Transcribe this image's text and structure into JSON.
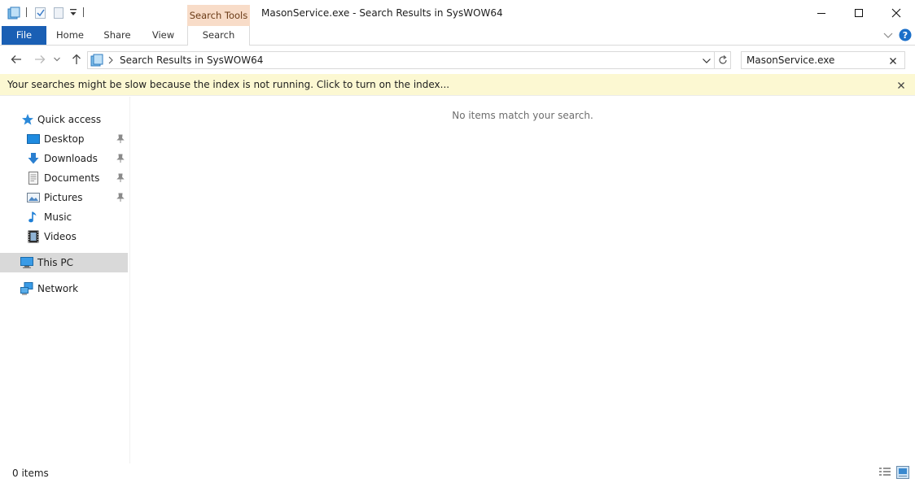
{
  "window": {
    "title": "MasonService.exe - Search Results in SysWOW64",
    "contextual_tab_group": "Search Tools"
  },
  "ribbon": {
    "tabs": [
      {
        "label": "File",
        "active": true
      },
      {
        "label": "Home"
      },
      {
        "label": "Share"
      },
      {
        "label": "View"
      },
      {
        "label": "Search"
      }
    ]
  },
  "address": {
    "path": "Search Results in SysWOW64",
    "search_value": "MasonService.exe"
  },
  "infobar": {
    "message": "Your searches might be slow because the index is not running.  Click to turn on the index..."
  },
  "navigation": {
    "quick_access": "Quick access",
    "items": [
      {
        "label": "Desktop",
        "icon": "desktop-icon",
        "pinned": true
      },
      {
        "label": "Downloads",
        "icon": "downloads-icon",
        "pinned": true
      },
      {
        "label": "Documents",
        "icon": "documents-icon",
        "pinned": true
      },
      {
        "label": "Pictures",
        "icon": "pictures-icon",
        "pinned": true
      },
      {
        "label": "Music",
        "icon": "music-icon",
        "pinned": false
      },
      {
        "label": "Videos",
        "icon": "videos-icon",
        "pinned": false
      }
    ],
    "this_pc": "This PC",
    "network": "Network"
  },
  "content": {
    "empty_message": "No items match your search."
  },
  "status": {
    "item_count": "0 items"
  },
  "colors": {
    "accent": "#1a5fb4",
    "contextual_tab": "#f8dcc8",
    "infobar": "#fcf8d2",
    "selected": "#d9d9d9"
  }
}
